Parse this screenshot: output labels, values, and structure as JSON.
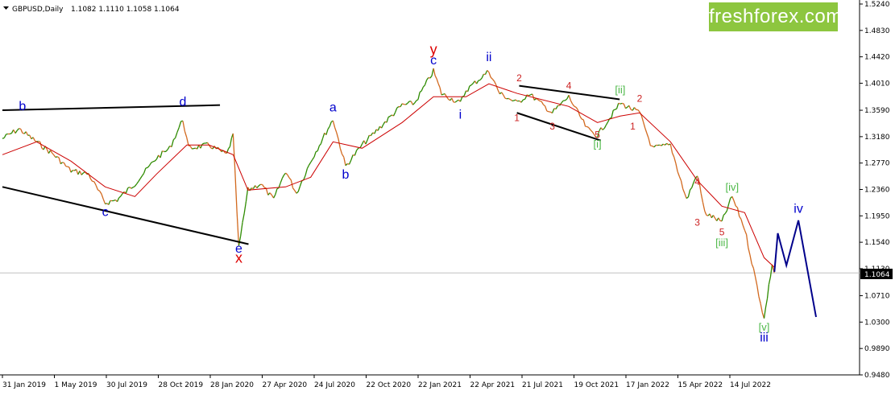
{
  "header": {
    "menu_icon": "triangle-down-icon",
    "symbol_timeframe": "GBPUSD,Daily",
    "ohlc": "1.1082 1.1110 1.1058 1.1064"
  },
  "logo": {
    "text": "freshforex.com",
    "color": "#8dc63f"
  },
  "price_tag": "1.1064",
  "chart_data": {
    "type": "line",
    "title": "GBPUSD,Daily",
    "y_ticks": [
      "1.5240",
      "1.4830",
      "1.4420",
      "1.4010",
      "1.3590",
      "1.3180",
      "1.2770",
      "1.2360",
      "1.1950",
      "1.1540",
      "1.1130",
      "1.0710",
      "1.0300",
      "0.9890",
      "0.9480"
    ],
    "x_ticks": [
      "31 Jan 2019",
      "1 May 2019",
      "30 Jul 2019",
      "28 Oct 2019",
      "28 Jan 2020",
      "27 Apr 2020",
      "24 Jul 2020",
      "22 Oct 2020",
      "22 Jan 2021",
      "22 Apr 2021",
      "21 Jul 2021",
      "19 Oct 2021",
      "17 Jan 2022",
      "15 Apr 2022",
      "14 Jul 2022"
    ],
    "ylim": [
      0.948,
      1.524
    ],
    "current_price": 1.1064,
    "price_path": [
      [
        "2019-01-31",
        1.315
      ],
      [
        "2019-03-01",
        1.33
      ],
      [
        "2019-04-01",
        1.31
      ],
      [
        "2019-05-01",
        1.29
      ],
      [
        "2019-05-31",
        1.265
      ],
      [
        "2019-07-01",
        1.26
      ],
      [
        "2019-07-30",
        1.215
      ],
      [
        "2019-08-20",
        1.22
      ],
      [
        "2019-09-20",
        1.245
      ],
      [
        "2019-10-28",
        1.285
      ],
      [
        "2019-11-20",
        1.3
      ],
      [
        "2019-12-13",
        1.345
      ],
      [
        "2019-12-23",
        1.3
      ],
      [
        "2020-01-28",
        1.305
      ],
      [
        "2020-02-28",
        1.29
      ],
      [
        "2020-03-10",
        1.32
      ],
      [
        "2020-03-20",
        1.145
      ],
      [
        "2020-04-05",
        1.235
      ],
      [
        "2020-04-27",
        1.245
      ],
      [
        "2020-05-20",
        1.22
      ],
      [
        "2020-06-10",
        1.265
      ],
      [
        "2020-06-29",
        1.23
      ],
      [
        "2020-07-24",
        1.28
      ],
      [
        "2020-09-01",
        1.345
      ],
      [
        "2020-09-23",
        1.272
      ],
      [
        "2020-10-22",
        1.305
      ],
      [
        "2020-11-25",
        1.335
      ],
      [
        "2020-12-31",
        1.367
      ],
      [
        "2021-01-22",
        1.37
      ],
      [
        "2021-02-24",
        1.42
      ],
      [
        "2021-03-10",
        1.385
      ],
      [
        "2021-04-12",
        1.37
      ],
      [
        "2021-04-22",
        1.39
      ],
      [
        "2021-06-01",
        1.42
      ],
      [
        "2021-06-20",
        1.385
      ],
      [
        "2021-07-21",
        1.37
      ],
      [
        "2021-08-10",
        1.385
      ],
      [
        "2021-09-20",
        1.355
      ],
      [
        "2021-10-19",
        1.38
      ],
      [
        "2021-11-20",
        1.33
      ],
      [
        "2021-12-08",
        1.32
      ],
      [
        "2022-01-17",
        1.37
      ],
      [
        "2022-02-20",
        1.355
      ],
      [
        "2022-03-14",
        1.3
      ],
      [
        "2022-04-15",
        1.305
      ],
      [
        "2022-05-13",
        1.22
      ],
      [
        "2022-06-01",
        1.26
      ],
      [
        "2022-06-14",
        1.2
      ],
      [
        "2022-07-14",
        1.185
      ],
      [
        "2022-08-01",
        1.225
      ],
      [
        "2022-08-23",
        1.175
      ],
      [
        "2022-09-26",
        1.035
      ],
      [
        "2022-10-10",
        1.12
      ],
      [
        "2022-10-14",
        1.1064
      ]
    ],
    "moving_average": [
      [
        "2019-01-31",
        1.29
      ],
      [
        "2019-04-01",
        1.31
      ],
      [
        "2019-05-31",
        1.28
      ],
      [
        "2019-07-30",
        1.24
      ],
      [
        "2019-09-20",
        1.225
      ],
      [
        "2019-10-28",
        1.26
      ],
      [
        "2019-12-20",
        1.305
      ],
      [
        "2020-01-28",
        1.305
      ],
      [
        "2020-03-10",
        1.29
      ],
      [
        "2020-04-05",
        1.235
      ],
      [
        "2020-06-10",
        1.24
      ],
      [
        "2020-07-24",
        1.255
      ],
      [
        "2020-09-01",
        1.31
      ],
      [
        "2020-10-22",
        1.3
      ],
      [
        "2020-12-31",
        1.34
      ],
      [
        "2021-02-24",
        1.38
      ],
      [
        "2021-04-22",
        1.38
      ],
      [
        "2021-06-01",
        1.4
      ],
      [
        "2021-07-21",
        1.385
      ],
      [
        "2021-10-19",
        1.365
      ],
      [
        "2021-12-08",
        1.34
      ],
      [
        "2022-01-17",
        1.35
      ],
      [
        "2022-02-20",
        1.355
      ],
      [
        "2022-04-15",
        1.31
      ],
      [
        "2022-06-01",
        1.25
      ],
      [
        "2022-07-14",
        1.21
      ],
      [
        "2022-08-23",
        1.2
      ],
      [
        "2022-09-26",
        1.13
      ],
      [
        "2022-10-14",
        1.115
      ]
    ],
    "projection": [
      [
        "2022-10-14",
        1.108
      ],
      [
        "2022-10-20",
        1.168
      ],
      [
        "2022-11-04",
        1.118
      ],
      [
        "2022-11-25",
        1.188
      ],
      [
        "2022-12-26",
        1.038
      ]
    ],
    "trend_lines": [
      [
        [
          "2019-01-31",
          1.359
        ],
        [
          "2020-02-16",
          1.367
        ]
      ],
      [
        [
          "2019-01-31",
          1.24
        ],
        [
          "2020-04-06",
          1.151
        ]
      ],
      [
        [
          "2021-07-24",
          1.397
        ],
        [
          "2022-01-16",
          1.376
        ]
      ],
      [
        [
          "2021-07-20",
          1.355
        ],
        [
          "2021-12-14",
          1.312
        ]
      ]
    ],
    "wave_labels": [
      {
        "text": "b",
        "date": "2019-03-07",
        "price": 1.359,
        "color": "#0000cc"
      },
      {
        "text": "c",
        "date": "2019-07-30",
        "price": 1.195,
        "color": "#0000cc"
      },
      {
        "text": "d",
        "date": "2019-12-13",
        "price": 1.366,
        "color": "#0000cc"
      },
      {
        "text": "e",
        "date": "2020-03-20",
        "price": 1.138,
        "color": "#0000cc"
      },
      {
        "text": "x",
        "date": "2020-03-20",
        "price": 1.122,
        "color": "#dd0000"
      },
      {
        "text": "a",
        "date": "2020-09-01",
        "price": 1.357,
        "color": "#0000cc"
      },
      {
        "text": "b",
        "date": "2020-09-23",
        "price": 1.253,
        "color": "#0000cc"
      },
      {
        "text": "y",
        "date": "2021-02-24",
        "price": 1.446,
        "color": "#dd0000"
      },
      {
        "text": "c",
        "date": "2021-02-24",
        "price": 1.43,
        "color": "#0000cc"
      },
      {
        "text": "i",
        "date": "2021-04-12",
        "price": 1.346,
        "color": "#0000cc"
      },
      {
        "text": "ii",
        "date": "2021-06-01",
        "price": 1.435,
        "color": "#0000cc"
      },
      {
        "text": "2",
        "date": "2021-07-24",
        "price": 1.404,
        "color": "#cc2222"
      },
      {
        "text": "1",
        "date": "2021-07-20",
        "price": 1.342,
        "color": "#cc2222"
      },
      {
        "text": "3",
        "date": "2021-09-20",
        "price": 1.329,
        "color": "#cc2222"
      },
      {
        "text": "4",
        "date": "2021-10-19",
        "price": 1.392,
        "color": "#cc2222"
      },
      {
        "text": "5",
        "date": "2021-12-08",
        "price": 1.316,
        "color": "#cc2222"
      },
      {
        "text": "[i]",
        "date": "2021-12-08",
        "price": 1.301,
        "color": "#4db848"
      },
      {
        "text": "[ii]",
        "date": "2022-01-17",
        "price": 1.385,
        "color": "#4db848"
      },
      {
        "text": "1",
        "date": "2022-02-08",
        "price": 1.329,
        "color": "#cc2222"
      },
      {
        "text": "2",
        "date": "2022-02-20",
        "price": 1.372,
        "color": "#cc2222"
      },
      {
        "text": "4",
        "date": "2022-06-01",
        "price": 1.243,
        "color": "#cc2222"
      },
      {
        "text": "3",
        "date": "2022-06-01",
        "price": 1.18,
        "color": "#cc2222"
      },
      {
        "text": "[iv]",
        "date": "2022-08-01",
        "price": 1.234,
        "color": "#4db848"
      },
      {
        "text": "5",
        "date": "2022-07-14",
        "price": 1.165,
        "color": "#cc2222"
      },
      {
        "text": "[iii]",
        "date": "2022-07-14",
        "price": 1.148,
        "color": "#4db848"
      },
      {
        "text": "iv",
        "date": "2022-11-25",
        "price": 1.2,
        "color": "#0000cc"
      },
      {
        "text": "[v]",
        "date": "2022-09-26",
        "price": 1.017,
        "color": "#4db848"
      },
      {
        "text": "iii",
        "date": "2022-09-26",
        "price": 1.0,
        "color": "#0000cc"
      }
    ],
    "colors": {
      "price": "#2e8b00",
      "price_alt": "#d2691e",
      "moving_average": "#cc0000",
      "trend_lines": "#000000",
      "projection": "#00008b",
      "current_price_line": "#c0c0c0",
      "price_tag_bg": "#000000"
    },
    "grid": false,
    "legend": "none"
  }
}
